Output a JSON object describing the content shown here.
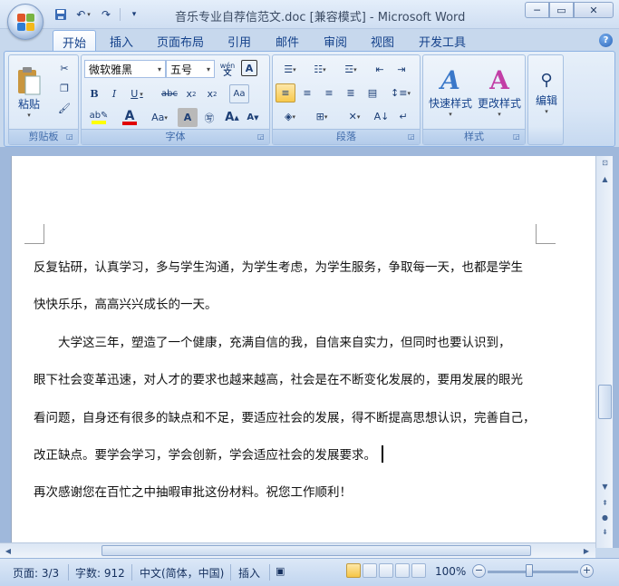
{
  "window": {
    "title": "音乐专业自荐信范文.doc [兼容模式] - Microsoft Word"
  },
  "tabs": [
    "开始",
    "插入",
    "页面布局",
    "引用",
    "邮件",
    "审阅",
    "视图",
    "开发工具"
  ],
  "ribbon": {
    "clipboard": {
      "label": "剪贴板",
      "paste": "粘贴"
    },
    "font": {
      "label": "字体",
      "font_name": "微软雅黑",
      "font_size": "五号",
      "wen": "wén"
    },
    "paragraph": {
      "label": "段落"
    },
    "styles": {
      "label": "样式",
      "quick_styles": "快速样式",
      "change_styles": "更改样式"
    },
    "editing": {
      "label": "编辑"
    }
  },
  "document": {
    "paragraphs": [
      "反复钻研，认真学习，多与学生沟通，为学生考虑，为学生服务，争取每一天，也都是学生",
      "快快乐乐，高高兴兴成长的一天。",
      "大学这三年，塑造了一个健康，充满自信的我，自信来自实力，但同时也要认识到，",
      "眼下社会变革迅速，对人才的要求也越来越高，社会是在不断变化发展的，要用发展的眼光",
      "看问题，自身还有很多的缺点和不足，要适应社会的发展，得不断提高思想认识，完善自己，",
      "改正缺点。要学会学习，学会创新，学会适应社会的发展要求。",
      "再次感谢您在百忙之中抽暇审批这份材料。祝您工作顺利！"
    ]
  },
  "status": {
    "page": "页面: 3/3",
    "words": "字数: 912",
    "language": "中文(简体，中国)",
    "mode": "插入",
    "zoom": "100%"
  },
  "colors": {
    "highlight": "#ffff00",
    "font_color": "#e00000"
  }
}
